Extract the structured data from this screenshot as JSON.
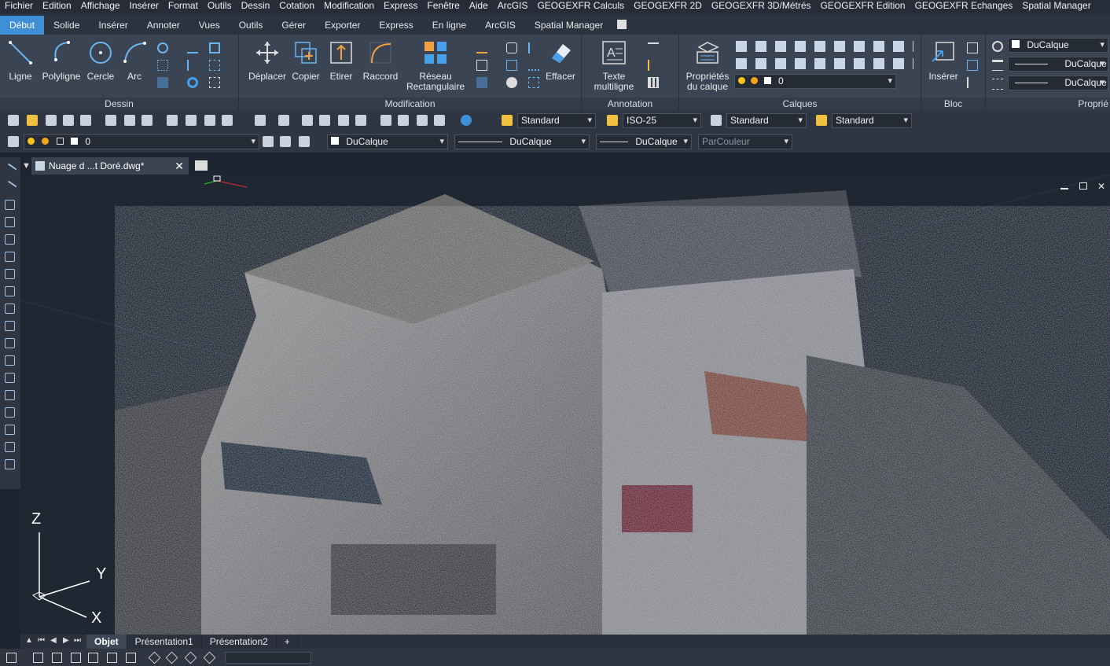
{
  "menu": [
    "Fichier",
    "Edition",
    "Affichage",
    "Insérer",
    "Format",
    "Outils",
    "Dessin",
    "Cotation",
    "Modification",
    "Express",
    "Fenêtre",
    "Aide",
    "ArcGIS",
    "GEOGEXFR Calculs",
    "GEOGEXFR 2D",
    "GEOGEXFR 3D/Métrés",
    "GEOGEXFR Edition",
    "GEOGEXFR Echanges",
    "Spatial Manager"
  ],
  "ribbon_tabs": [
    "Début",
    "Solide",
    "Insérer",
    "Annoter",
    "Vues",
    "Outils",
    "Gérer",
    "Exporter",
    "Express",
    "En ligne",
    "ArcGIS",
    "Spatial Manager"
  ],
  "active_tab": "Début",
  "panels": {
    "dessin": {
      "title": "Dessin",
      "buttons": [
        "Ligne",
        "Polyligne",
        "Cercle",
        "Arc"
      ]
    },
    "modification": {
      "title": "Modification",
      "buttons": [
        "Déplacer",
        "Copier",
        "Etirer",
        "Raccord",
        "Réseau Rectangulaire",
        "Effacer"
      ]
    },
    "annotation": {
      "title": "Annotation",
      "buttons": [
        "Texte multiligne"
      ]
    },
    "calques": {
      "title": "Calques",
      "buttons": [
        "Propriétés du calque"
      ],
      "layer_value": "0"
    },
    "bloc": {
      "title": "Bloc",
      "buttons": [
        "Insérer"
      ]
    },
    "proprietes": {
      "title": "Proprié",
      "rows": [
        "DuCalque",
        "DuCalque",
        "DuCalque"
      ]
    }
  },
  "toolbar1": {
    "text_style": "Standard",
    "dim_style": "ISO-25",
    "table_style": "Standard",
    "multileader_style": "Standard"
  },
  "toolbar2": {
    "layer": "0",
    "color": "DuCalque",
    "linetype": "DuCalque",
    "lineweight": "DuCalque",
    "plotstyle": "ParCouleur"
  },
  "document_tab": "Nuage d ...t Doré.dwg*",
  "axes": {
    "z": "Z",
    "y": "Y",
    "x": "X"
  },
  "layout_tabs": [
    "Objet",
    "Présentation1",
    "Présentation2",
    "+"
  ],
  "colors": {
    "accent": "#3e8fd6",
    "ribbon_bg": "#3b4453",
    "viewport_bg": "#1f2733"
  }
}
